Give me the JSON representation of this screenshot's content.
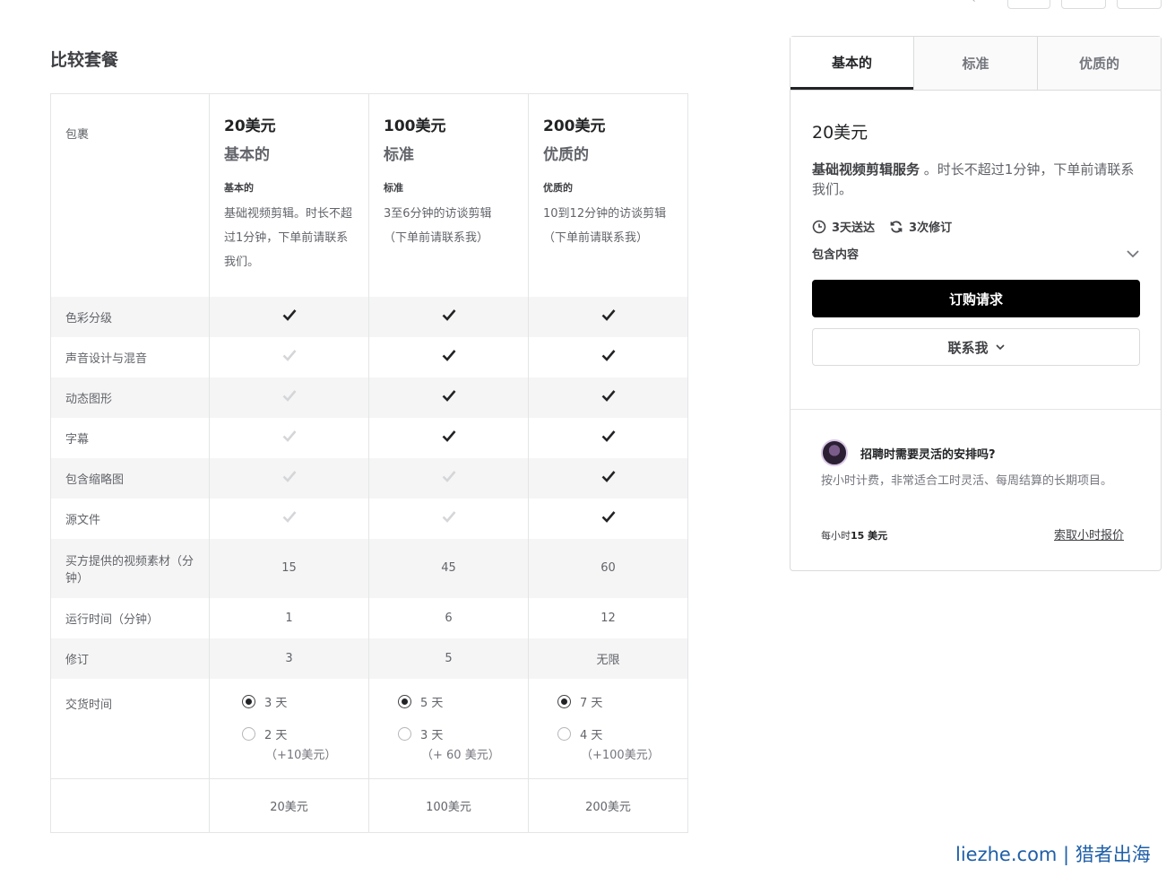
{
  "page": {
    "title": "比较套餐"
  },
  "packages": [
    {
      "price": "20美元",
      "name": "基本的",
      "short": "基本的",
      "desc": "基础视频剪辑。时长不超过1分钟，下单前请联系我们。"
    },
    {
      "price": "100美元",
      "name": "标准",
      "short": "标准",
      "desc": "3至6分钟的访谈剪辑（下单前请联系我）"
    },
    {
      "price": "200美元",
      "name": "优质的",
      "short": "优质的",
      "desc": "10到12分钟的访谈剪辑（下单前请联系我）"
    }
  ],
  "table": {
    "package_label": "包裹",
    "feature_rows": [
      {
        "label": "色彩分级",
        "values": [
          true,
          true,
          true
        ]
      },
      {
        "label": "声音设计与混音",
        "values": [
          false,
          true,
          true
        ]
      },
      {
        "label": "动态图形",
        "values": [
          false,
          true,
          true
        ]
      },
      {
        "label": "字幕",
        "values": [
          false,
          true,
          true
        ]
      },
      {
        "label": "包含缩略图",
        "values": [
          false,
          false,
          true
        ]
      },
      {
        "label": "源文件",
        "values": [
          false,
          false,
          true
        ]
      }
    ],
    "value_rows": [
      {
        "label": "买方提供的视频素材（分钟）",
        "values": [
          "15",
          "45",
          "60"
        ]
      },
      {
        "label": "运行时间（分钟）",
        "values": [
          "1",
          "6",
          "12"
        ]
      },
      {
        "label": "修订",
        "values": [
          "3",
          "5",
          "无限"
        ]
      }
    ],
    "delivery": {
      "label": "交货时间",
      "options": [
        [
          {
            "text": "3 天",
            "extra": "",
            "selected": true
          },
          {
            "text": "2 天",
            "extra": "（+10美元）",
            "selected": false
          }
        ],
        [
          {
            "text": "5 天",
            "extra": "",
            "selected": true
          },
          {
            "text": "3 天",
            "extra": "（+ 60 美元）",
            "selected": false
          }
        ],
        [
          {
            "text": "7 天",
            "extra": "",
            "selected": true
          },
          {
            "text": "4 天",
            "extra": "（+100美元）",
            "selected": false
          }
        ]
      ]
    },
    "totals": [
      "20美元",
      "100美元",
      "200美元"
    ]
  },
  "card": {
    "tabs": [
      "基本的",
      "标准",
      "优质的"
    ],
    "active_tab": 0,
    "price": "20美元",
    "desc_bold": "基础视频剪辑服务",
    "desc_rest": " 。时长不超过1分钟，下单前请联系我们。",
    "delivery": "3天送达",
    "revisions": "3次修订",
    "included": "包含内容",
    "order_button": "订购请求",
    "contact_button": "联系我",
    "hire": {
      "title": "招聘时需要灵活的安排吗?",
      "desc": "按小时计费，非常适合工时灵活、每周结算的长期项目。",
      "rate_prefix": "每小时",
      "rate_value": "15 美元",
      "link": "索取小时报价"
    }
  },
  "watermark": "liezhe.com | 猎者出海",
  "colors": {
    "check_on": "#222325",
    "check_off": "#d5d6d9",
    "order_bg": "#000000",
    "watermark": "#1f5fa8"
  }
}
